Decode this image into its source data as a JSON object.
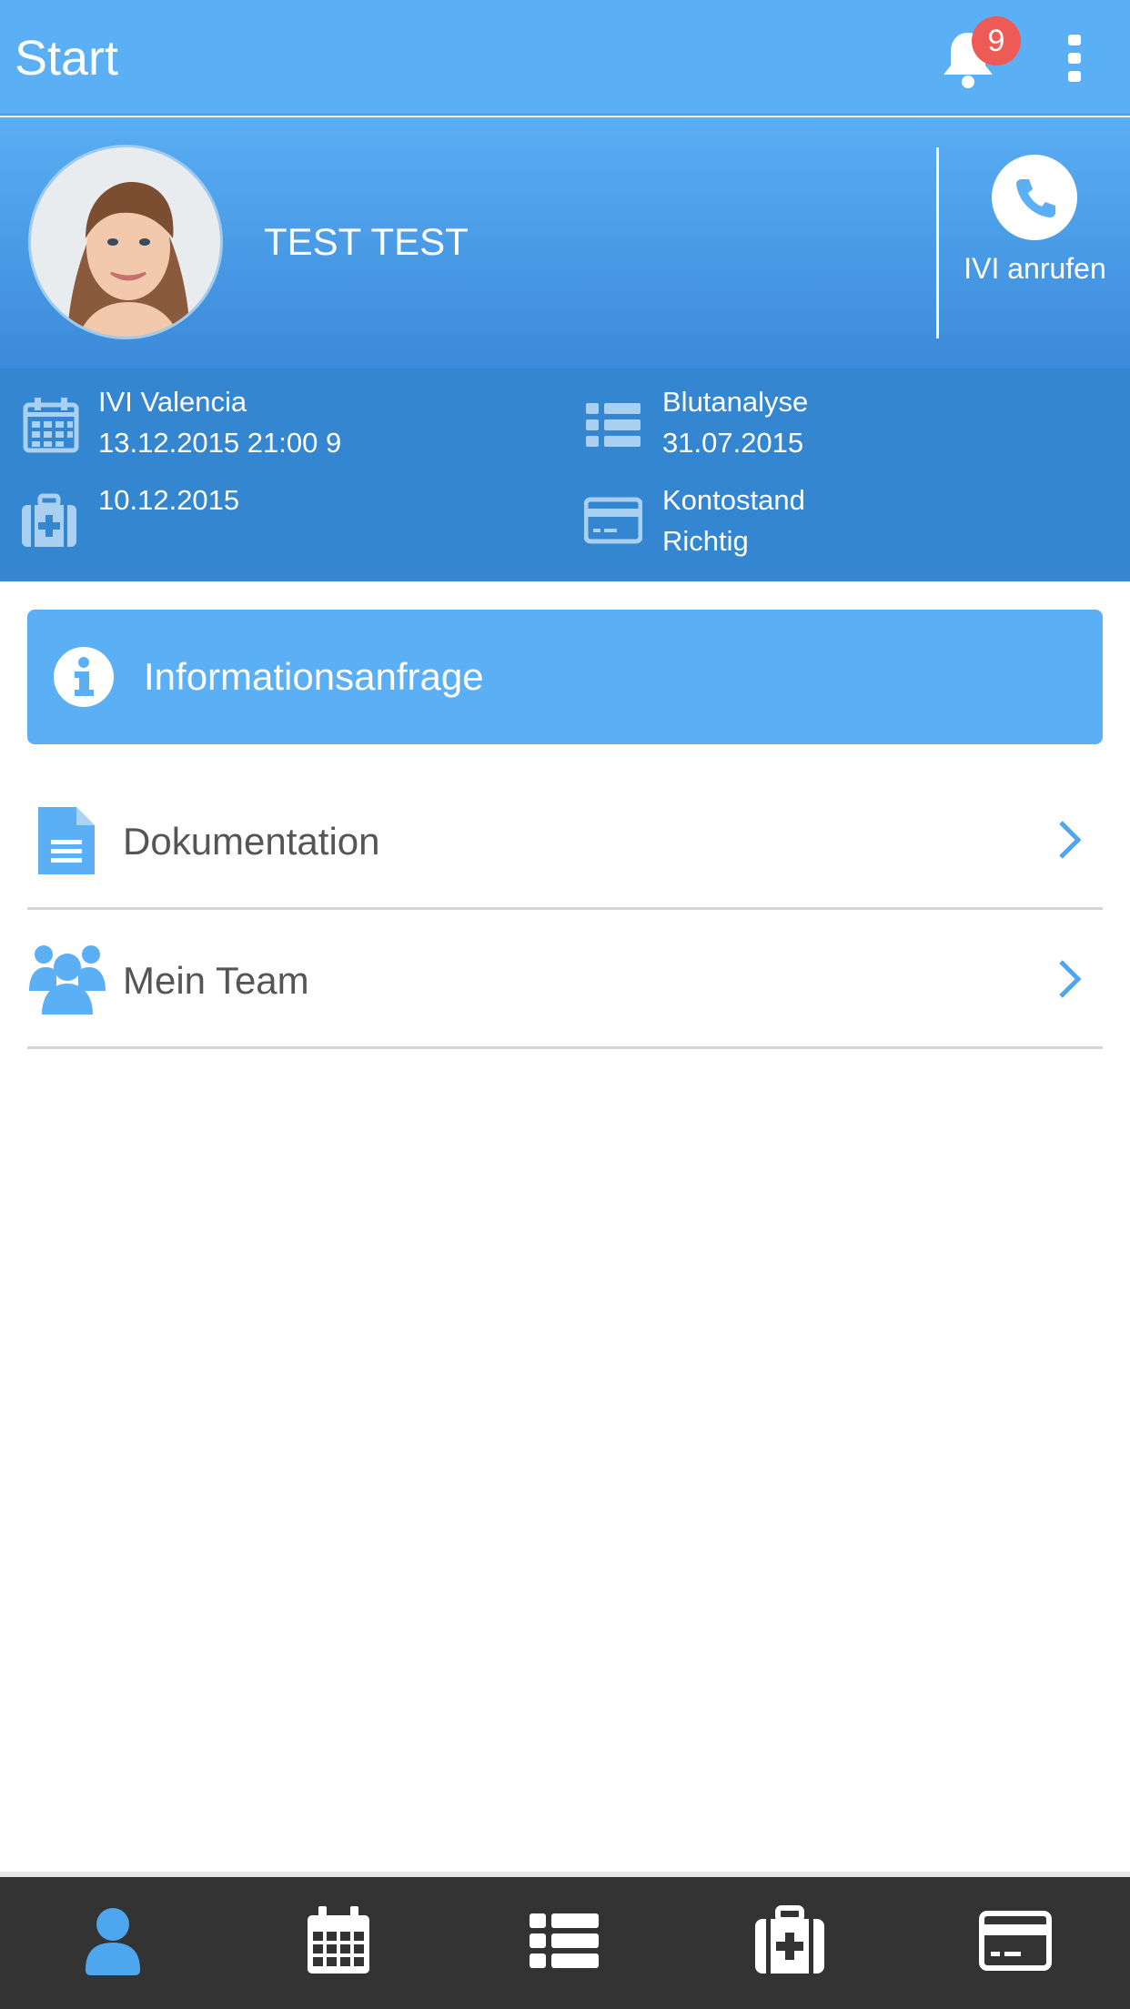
{
  "appbar": {
    "title": "Start",
    "notification_count": "9",
    "colors": {
      "primary": "#5AAFF5",
      "badge": "#EE5A55"
    }
  },
  "profile": {
    "name": "TEST TEST",
    "call_label": "IVI anrufen"
  },
  "info": {
    "appointment_line1": "IVI Valencia",
    "appointment_line2": "13.12.2015 21:00 9",
    "analysis_line1": "Blutanalyse",
    "analysis_line2": "31.07.2015",
    "treatment_line1": "10.12.2015",
    "account_line1": "Kontostand",
    "account_line2": "Richtig"
  },
  "info_request": {
    "label": "Informationsanfrage"
  },
  "menu": {
    "items": [
      {
        "label": "Dokumentation",
        "icon": "document-icon"
      },
      {
        "label": "Mein Team",
        "icon": "team-icon"
      }
    ]
  },
  "bottom_nav": {
    "tabs": [
      {
        "icon": "profile-icon",
        "active": true
      },
      {
        "icon": "calendar-icon",
        "active": false
      },
      {
        "icon": "list-icon",
        "active": false
      },
      {
        "icon": "medical-kit-icon",
        "active": false
      },
      {
        "icon": "credit-card-icon",
        "active": false
      }
    ],
    "colors": {
      "active": "#4DA6EE",
      "inactive": "#FFFFFF",
      "background": "#333333"
    }
  }
}
